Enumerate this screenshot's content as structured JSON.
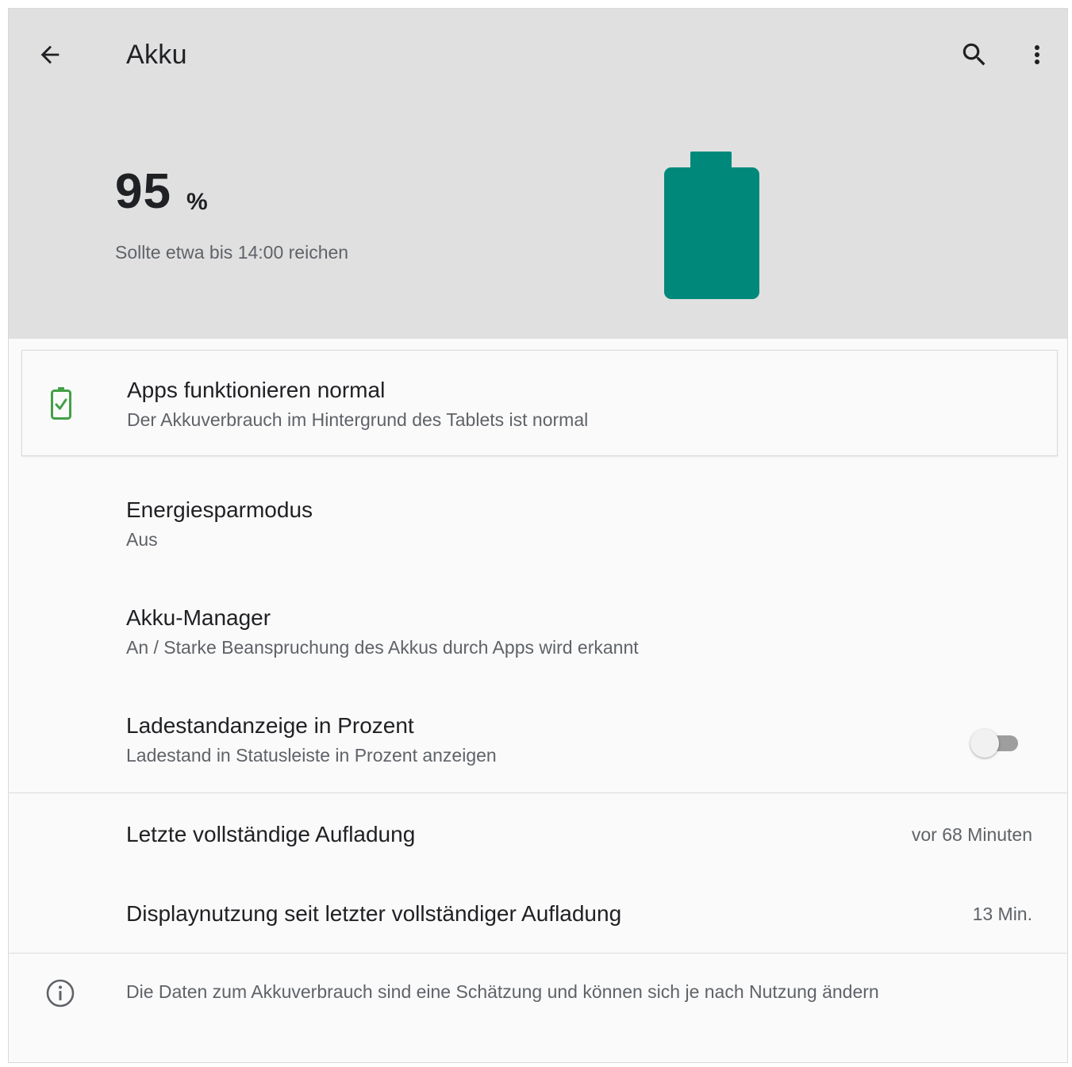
{
  "app_bar": {
    "title": "Akku",
    "back_icon": "arrow-back-icon",
    "search_icon": "search-icon",
    "more_icon": "more-vert-icon"
  },
  "battery": {
    "level": "95",
    "unit": "%",
    "level_fraction": 0.95,
    "estimate": "Sollte etwa bis 14:00 reichen",
    "color": "#00897b"
  },
  "suggestion_card": {
    "icon": "battery-check-icon",
    "icon_color": "#43a047",
    "title": "Apps funktionieren normal",
    "summary": "Der Akkuverbrauch im Hintergrund des Tablets ist normal"
  },
  "preferences": {
    "battery_saver": {
      "title": "Energiesparmodus",
      "summary": "Aus"
    },
    "battery_manager": {
      "title": "Akku-Manager",
      "summary": "An / Starke Beanspruchung des Akkus durch Apps wird erkannt"
    },
    "battery_percentage": {
      "title": "Ladestandanzeige in Prozent",
      "summary": "Ladestand in Statusleiste in Prozent anzeigen",
      "enabled": false
    }
  },
  "usage": {
    "last_full_charge": {
      "title": "Letzte vollständige Aufladung",
      "value": "vor 68 Minuten"
    },
    "screen_usage": {
      "title": "Displaynutzung seit letzter vollständiger Aufladung",
      "value": "13 Min."
    }
  },
  "footer": {
    "icon": "info-icon",
    "text": "Die Daten zum Akkuverbrauch sind eine Schätzung und können sich je nach Nutzung ändern"
  }
}
